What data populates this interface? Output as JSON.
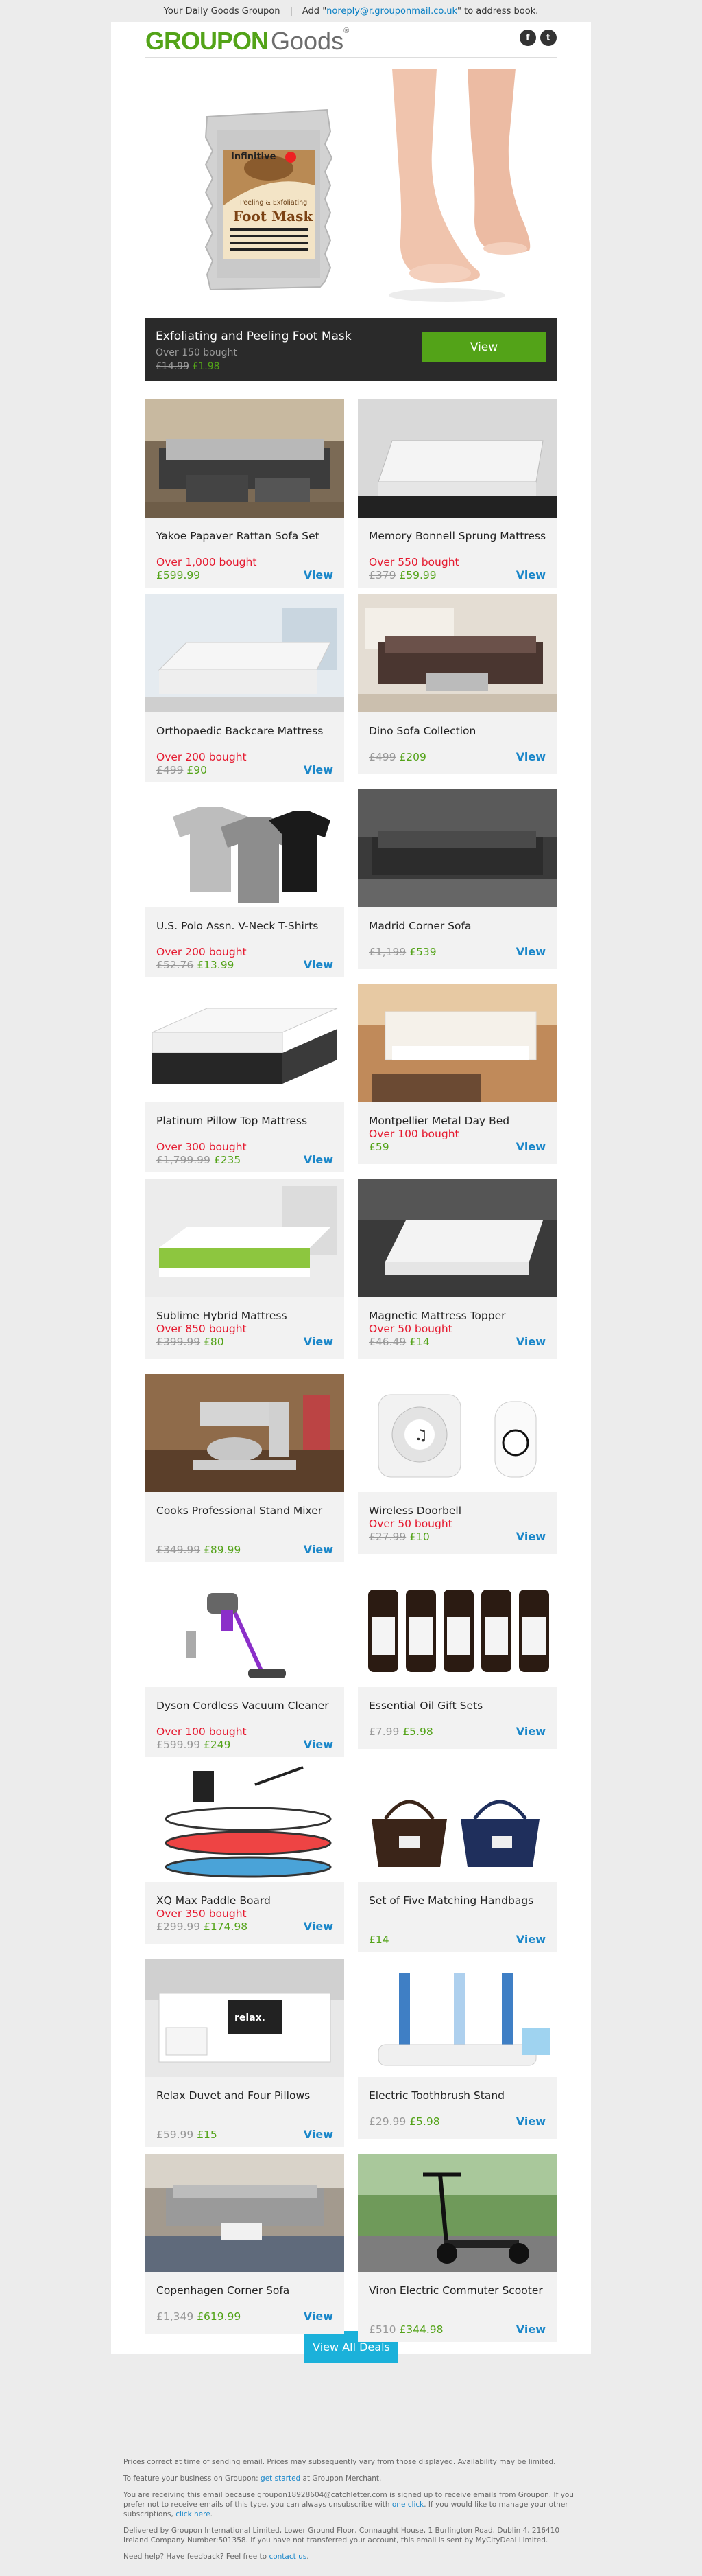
{
  "topbar": {
    "text_a": "Your Daily Goods Groupon",
    "sep": "|",
    "text_b": "Add \"",
    "email": "noreply@r.grouponmail.co.uk",
    "text_c": "\" to address book."
  },
  "header": {
    "logo_main": "GROUPON",
    "logo_sub": "Goods",
    "logo_tm": "®",
    "social": [
      "f",
      "t"
    ]
  },
  "hero": {
    "product_label_brand": "Infinitive",
    "product_label_line": "Peeling & Exfoliating",
    "product_label_name": "Foot Mask",
    "title": "Exfoliating and Peeling Foot Mask",
    "sub": "Over 150 bought",
    "was": "£14.99",
    "now": "£1.98",
    "view": "View"
  },
  "deals": [
    {
      "title": "Yakoe Papaver Rattan Sofa Set",
      "bought": "Over 1,000 bought",
      "was": "",
      "now": "£599.99",
      "view": "View"
    },
    {
      "title": "Memory Bonnell Sprung Mattress",
      "bought": "Over 550 bought",
      "was": "£379",
      "now": "£59.99",
      "view": "View"
    },
    {
      "title": "Orthopaedic Backcare Mattress",
      "bought": "Over 200 bought",
      "was": "£499",
      "now": "£90",
      "view": "View"
    },
    {
      "title": "Dino Sofa Collection",
      "bought": "",
      "was": "£499",
      "now": "£209",
      "view": "View"
    },
    {
      "title": "U.S. Polo Assn. V-Neck T-Shirts",
      "bought": "Over 200 bought",
      "was": "£52.76",
      "now": "£13.99",
      "view": "View"
    },
    {
      "title": "Madrid Corner Sofa",
      "bought": "",
      "was": "£1,199",
      "now": "£539",
      "view": "View"
    },
    {
      "title": "Platinum Pillow Top Mattress",
      "bought": "Over 300 bought",
      "was": "£1,799.99",
      "now": "£235",
      "view": "View"
    },
    {
      "title": "Montpellier Metal Day Bed",
      "bought": "Over 100 bought",
      "was": "",
      "now": "£59",
      "view": "View"
    },
    {
      "title": "Sublime Hybrid Mattress",
      "bought": "Over 850 bought",
      "was": "£399.99",
      "now": "£80",
      "view": "View"
    },
    {
      "title": "Magnetic Mattress Topper",
      "bought": "Over 50 bought",
      "was": "£46.49",
      "now": "£14",
      "view": "View"
    },
    {
      "title": "Cooks Professional Stand Mixer",
      "bought": "",
      "was": "£349.99",
      "now": "£89.99",
      "view": "View"
    },
    {
      "title": "Wireless Doorbell",
      "bought": "Over 50 bought",
      "was": "£27.99",
      "now": "£10",
      "view": "View"
    },
    {
      "title": "Dyson Cordless Vacuum Cleaner",
      "bought": "Over 100 bought",
      "was": "£599.99",
      "now": "£249",
      "view": "View"
    },
    {
      "title": "Essential Oil Gift Sets",
      "bought": "",
      "was": "£7.99",
      "now": "£5.98",
      "view": "View"
    },
    {
      "title": "XQ Max Paddle Board",
      "bought": "Over 350 bought",
      "was": "£299.99",
      "now": "£174.98",
      "view": "View"
    },
    {
      "title": "Set of Five Matching Handbags",
      "bought": "",
      "was": "",
      "now": "£14",
      "view": "View"
    },
    {
      "title": "Relax Duvet and Four Pillows",
      "bought": "",
      "was": "£59.99",
      "now": "£15",
      "view": "View"
    },
    {
      "title": "Electric Toothbrush Stand",
      "bought": "",
      "was": "£29.99",
      "now": "£5.98",
      "view": "View"
    },
    {
      "title": "Copenhagen Corner Sofa",
      "bought": "",
      "was": "£1,349",
      "now": "£619.99",
      "view": "View"
    },
    {
      "title": "Viron Electric Commuter Scooter",
      "bought": "",
      "was": "£510",
      "now": "£344.98",
      "view": "View"
    }
  ],
  "viewall": "View All Deals",
  "footer": {
    "p1": "Prices correct at time of sending email. Prices may subsequently vary from those displayed. Availability may be limited.",
    "p2_a": "To feature your business on Groupon: ",
    "p2_link": "get started",
    "p2_b": " at Groupon Merchant.",
    "p3_a": "You are receiving this email because groupon18928604@catchletter.com is signed up to receive emails from Groupon. If you prefer not to receive emails of this type, you can always unsubscribe with ",
    "p3_link": "one click",
    "p3_b": ". If you would like to manage your other subscriptions, ",
    "p3_link2": "click here",
    "p3_c": ".",
    "p4": "Delivered by Groupon International Limited, Lower Ground Floor, Connaught House, 1 Burlington Road, Dublin 4, 216410 Ireland Company Number:501358. If you have not transferred your account, this email is sent by MyCityDeal Limited.",
    "p5_a": "Need help? Have feedback? Feel free to ",
    "p5_link": "contact us",
    "p5_b": "."
  },
  "colors": {
    "brand": "#53a318",
    "accent": "#1b87c9",
    "bought": "#e5192f",
    "hero_strip": "#2a2a2a"
  }
}
